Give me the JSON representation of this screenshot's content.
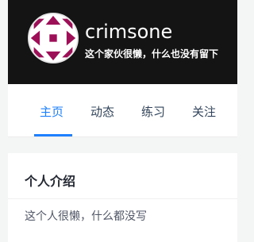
{
  "profile": {
    "username": "crimsone",
    "bio": "这个家伙很懒，什么也没有留下",
    "avatar": {
      "icon": "geometric-avatar-icon",
      "accent": "#9c1058",
      "bg": "#ffffff"
    }
  },
  "tabs": [
    {
      "label": "主页",
      "active": true
    },
    {
      "label": "动态",
      "active": false
    },
    {
      "label": "练习",
      "active": false
    },
    {
      "label": "关注",
      "active": false
    }
  ],
  "intro": {
    "title": "个人介绍",
    "text": "这个人很懒，什么都没写"
  },
  "colors": {
    "banner_bg": "#141414",
    "tab_active": "#1e80ff",
    "tab_text": "#31445b",
    "page_bg": "#f4f5f5"
  }
}
